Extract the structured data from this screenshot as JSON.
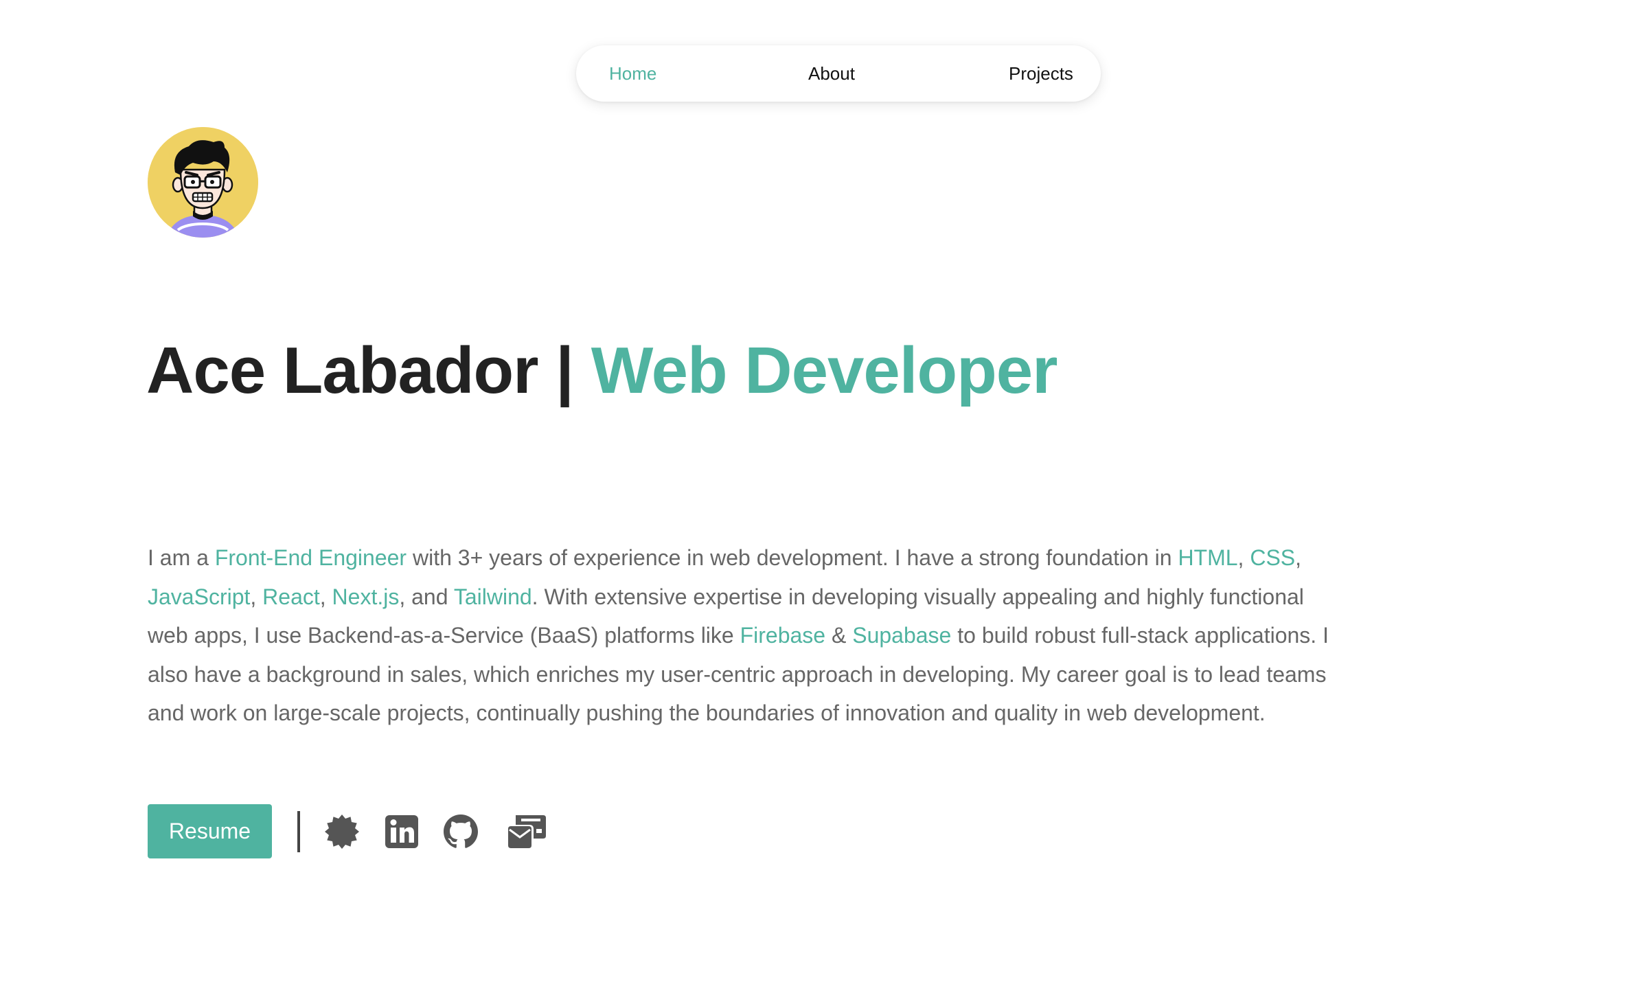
{
  "nav": {
    "items": [
      {
        "label": "Home",
        "active": true
      },
      {
        "label": "About",
        "active": false
      },
      {
        "label": "Projects",
        "active": false
      }
    ]
  },
  "hero": {
    "name": "Ace Labador",
    "separator": " | ",
    "role": "Web Developer"
  },
  "bio": {
    "segments": [
      {
        "text": "I am a ",
        "highlight": false
      },
      {
        "text": "Front-End Engineer",
        "highlight": true
      },
      {
        "text": " with 3+ years of experience in web development. I have a strong foundation in ",
        "highlight": false
      },
      {
        "text": "HTML",
        "highlight": true
      },
      {
        "text": ", ",
        "highlight": false
      },
      {
        "text": "CSS",
        "highlight": true
      },
      {
        "text": ", ",
        "highlight": false
      },
      {
        "text": "JavaScript",
        "highlight": true
      },
      {
        "text": ", ",
        "highlight": false
      },
      {
        "text": "React",
        "highlight": true
      },
      {
        "text": ", ",
        "highlight": false
      },
      {
        "text": "Next.js",
        "highlight": true
      },
      {
        "text": ", and ",
        "highlight": false
      },
      {
        "text": "Tailwind",
        "highlight": true
      },
      {
        "text": ". With extensive expertise in developing visually appealing and highly functional web apps, I use Backend-as-a-Service (BaaS) platforms like ",
        "highlight": false
      },
      {
        "text": "Firebase",
        "highlight": true
      },
      {
        "text": " & ",
        "highlight": false
      },
      {
        "text": "Supabase",
        "highlight": true
      },
      {
        "text": " to build robust full-stack applications. I also have a background in sales, which enriches my user-centric approach in developing. My career goal is to lead teams and work on large-scale projects, continually pushing the boundaries of innovation and quality in web development.",
        "highlight": false
      }
    ]
  },
  "actions": {
    "resume_label": "Resume",
    "social_icons": [
      "badge-icon",
      "linkedin-icon",
      "github-icon",
      "mail-icon"
    ]
  },
  "colors": {
    "accent": "#4fb3a0",
    "heading": "#222222",
    "body_text": "#666666",
    "icon": "#555555",
    "avatar_bg": "#efd163"
  }
}
